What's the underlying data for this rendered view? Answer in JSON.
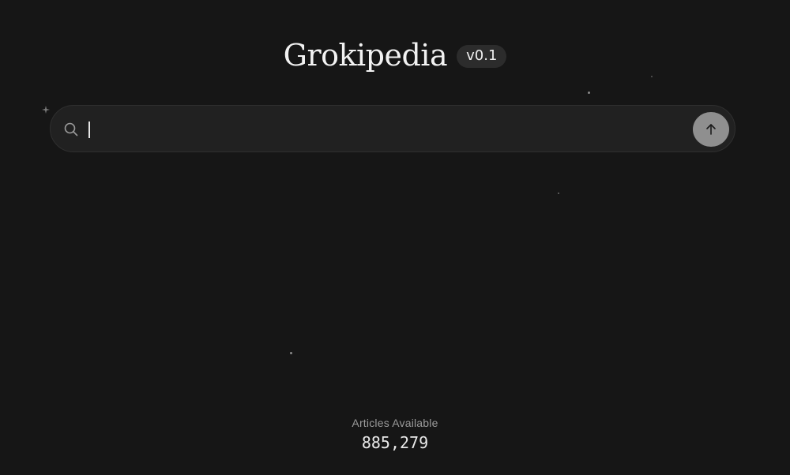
{
  "header": {
    "title": "Grokipedia",
    "version": "v0.1"
  },
  "search": {
    "value": "",
    "placeholder": "",
    "icon": "search-icon",
    "submit_icon": "arrow-up-icon"
  },
  "stats": {
    "label": "Articles Available",
    "count": "885,279"
  },
  "colors": {
    "background": "#161616",
    "search_background": "#212121",
    "submit_button": "#8f8f8f",
    "badge_background": "#2c2c2c"
  }
}
